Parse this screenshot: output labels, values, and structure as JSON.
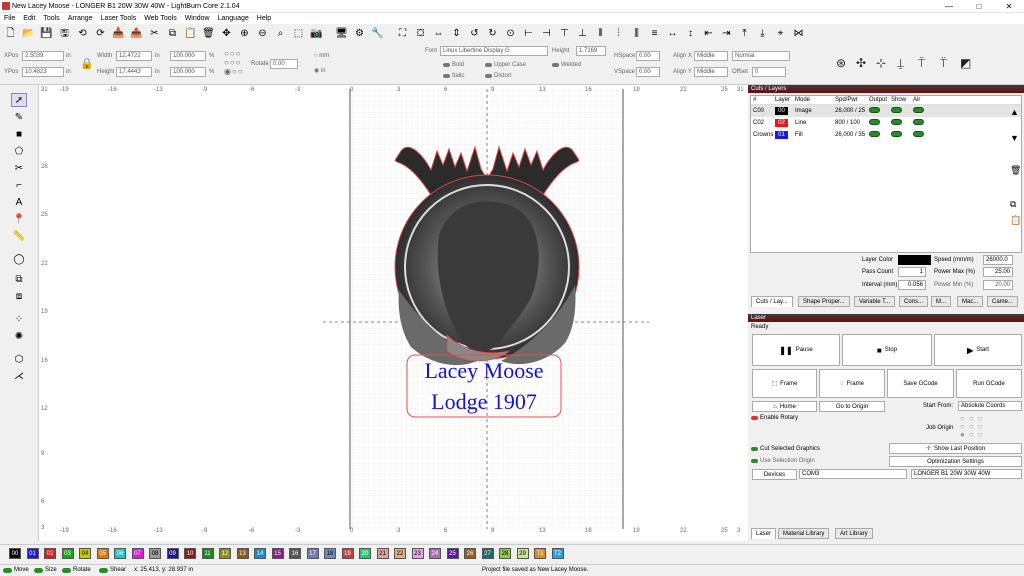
{
  "window": {
    "title": "New Lacey Moose - LONGER B1 20W 30W 40W - LightBurn Core 2.1.04",
    "controls": [
      "—",
      "□",
      "✕"
    ]
  },
  "menu": [
    "File",
    "Edit",
    "Tools",
    "Arrange",
    "Laser Tools",
    "Web Tools",
    "Window",
    "Language",
    "Help"
  ],
  "props": {
    "xpos_label": "XPos",
    "xpos": "2.5039",
    "ypos_label": "YPos",
    "ypos": "10.4823",
    "unit_in": "in",
    "width_label": "Width",
    "width": "12.4722",
    "height_label": "Height",
    "height": "17.4443",
    "scale_w": "100.000",
    "scale_h": "100.000",
    "pct": "%",
    "rotate_label": "Rotate",
    "rotate": "0.00",
    "mm": "mm",
    "in": "in",
    "font_label": "Font",
    "font": "Linux Libertine Display G",
    "fheight_label": "Height",
    "fheight": "1.7169",
    "hspace_label": "HSpace",
    "hspace": "0.00",
    "vspace_label": "VSpace",
    "vspace": "0.00",
    "alignx_label": "Align X",
    "alignx": "Middle",
    "aligny_label": "Align Y",
    "aligny": "Middle",
    "normal": "Normal",
    "offset_label": "Offset",
    "offset": "0",
    "bold": "Bold",
    "italic": "Italic",
    "upper": "Upper Case",
    "distort": "Distort",
    "welded": "Welded"
  },
  "canvas": {
    "top_ticks": [
      "-19",
      "-16",
      "-13",
      "-9",
      "-6",
      "-3",
      "0",
      "3",
      "6",
      "9",
      "13",
      "16",
      "19",
      "22",
      "25"
    ],
    "bottom_ticks": [
      "-19",
      "-16",
      "-13",
      "-9",
      "-6",
      "-3",
      "0",
      "3",
      "6",
      "9",
      "13",
      "16",
      "19",
      "22",
      "25"
    ],
    "left_ticks": [
      "31",
      "28",
      "25",
      "22",
      "19",
      "16",
      "12",
      "9",
      "6",
      "3"
    ],
    "top_right": "31",
    "bottom_right": "3",
    "text_line1": "Lacey Moose",
    "text_line2": "Lodge 1907",
    "text_color": "#1515c8"
  },
  "cuts": {
    "title": "Cuts / Layers",
    "headers": [
      "#",
      "Layer",
      "Mode",
      "Spd/Pwr",
      "Output",
      "Show",
      "Air"
    ],
    "rows": [
      {
        "name": "C00",
        "layer": "00",
        "color": "#000000",
        "mode": "Image",
        "spdpwr": "26,000 / 25"
      },
      {
        "name": "C02",
        "layer": "02",
        "color": "#e41a1a",
        "mode": "Line",
        "spdpwr": "800 / 100"
      },
      {
        "name": "Crowns",
        "layer": "01",
        "color": "#1a1ae4",
        "mode": "Fill",
        "spdpwr": "26,000 / 35"
      }
    ],
    "layer_color_label": "Layer Color",
    "speed_label": "Speed (mm/m)",
    "speed": "26000.0",
    "pass_label": "Pass Count",
    "pass": "1",
    "pmax_label": "Power Max (%)",
    "pmax": "25.00",
    "interval_label": "Interval (mm)",
    "interval": "0.056",
    "pmin_label": "Power Min (%)",
    "pmin": "20.00",
    "tabs": [
      "Cuts / Lay...",
      "Shape Proper...",
      "Variable T...",
      "Cons...",
      "M...",
      "Mac...",
      "Came..."
    ]
  },
  "laser": {
    "title": "Laser",
    "status": "Ready",
    "pause": "Pause",
    "stop": "Stop",
    "start": "Start",
    "frame1": "Frame",
    "frame2": "Frame",
    "save_gcode": "Save GCode",
    "run_gcode": "Run GCode",
    "home": "Home",
    "goto_origin": "Go to Origin",
    "start_from_label": "Start From:",
    "start_from": "Absolute Coords",
    "enable_rotary": "Enable Rotary",
    "job_origin": "Job Origin",
    "cut_selected": "Cut Selected Graphics",
    "use_selection": "Use Selection Origin",
    "show_last": "Show Last Position",
    "optimization": "Optimization Settings",
    "devices": "Devices",
    "port": "COM3",
    "device": "LONGER B1 20W 30W 40W",
    "tabs": [
      "Laser",
      "Material Library",
      "Art Library"
    ]
  },
  "palette": [
    {
      "label": "00",
      "color": "#000000"
    },
    {
      "label": "01",
      "color": "#1a1ae4"
    },
    {
      "label": "02",
      "color": "#e41a1a"
    },
    {
      "label": "03",
      "color": "#1aa41a"
    },
    {
      "label": "04",
      "color": "#c8c800"
    },
    {
      "label": "05",
      "color": "#e07b00"
    },
    {
      "label": "06",
      "color": "#18c8c8"
    },
    {
      "label": "07",
      "color": "#e018e0"
    },
    {
      "label": "08",
      "color": "#999999"
    },
    {
      "label": "09",
      "color": "#1a1a8c"
    },
    {
      "label": "10",
      "color": "#8c1a1a"
    },
    {
      "label": "11",
      "color": "#1a8c1a"
    },
    {
      "label": "12",
      "color": "#8c8c1a"
    },
    {
      "label": "13",
      "color": "#8c5a1a"
    },
    {
      "label": "14",
      "color": "#1a8cc8"
    },
    {
      "label": "15",
      "color": "#8c1a8c"
    },
    {
      "label": "16",
      "color": "#555555"
    },
    {
      "label": "17",
      "color": "#6c7cb0"
    },
    {
      "label": "18",
      "color": "#6c8cc8"
    },
    {
      "label": "19",
      "color": "#c83c3c"
    },
    {
      "label": "20",
      "color": "#28c878"
    },
    {
      "label": "21",
      "color": "#e0a0a0"
    },
    {
      "label": "22",
      "color": "#e0b080"
    },
    {
      "label": "23",
      "color": "#f0a0f0"
    },
    {
      "label": "24",
      "color": "#b06cb0"
    },
    {
      "label": "25",
      "color": "#5a1aa0"
    },
    {
      "label": "26",
      "color": "#a05a1a"
    },
    {
      "label": "27",
      "color": "#1a6c6c"
    },
    {
      "label": "28",
      "color": "#90c850"
    },
    {
      "label": "29",
      "color": "#c8e890"
    },
    {
      "label": "T1",
      "color": "#e08c1a"
    },
    {
      "label": "T2",
      "color": "#28a0e0"
    }
  ],
  "status": {
    "move": "Move",
    "size": "Size",
    "rotate": "Rotate",
    "shear": "Shear",
    "coords": "x: 25.413, y: 28.937 in",
    "message": "Project file saved as New Lacey Moose."
  }
}
